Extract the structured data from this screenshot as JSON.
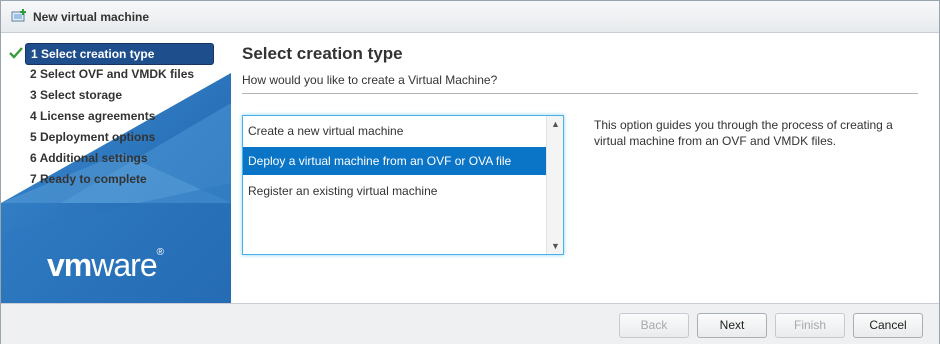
{
  "window": {
    "title": "New virtual machine",
    "icon": "new-vm-icon"
  },
  "sidebar": {
    "steps": [
      {
        "label": "1 Select creation type",
        "active": true,
        "completed": true
      },
      {
        "label": "2 Select OVF and VMDK files"
      },
      {
        "label": "3 Select storage"
      },
      {
        "label": "4 License agreements"
      },
      {
        "label": "5 Deployment options"
      },
      {
        "label": "6 Additional settings"
      },
      {
        "label": "7 Ready to complete"
      }
    ],
    "logo": {
      "bold": "vm",
      "rest": "ware",
      "mark": "®"
    }
  },
  "main": {
    "heading": "Select creation type",
    "question": "How would you like to create a Virtual Machine?",
    "options": [
      {
        "label": "Create a new virtual machine"
      },
      {
        "label": "Deploy a virtual machine from an OVF or OVA file",
        "selected": true
      },
      {
        "label": "Register an existing virtual machine"
      }
    ],
    "description": "This option guides you through the process of creating a virtual machine from an OVF and VMDK files."
  },
  "footer": {
    "back": "Back",
    "next": "Next",
    "finish": "Finish",
    "cancel": "Cancel"
  },
  "colors": {
    "accent": "#0a74c6",
    "active_step": "#1f4e8c",
    "sidebar_blue": "#2f7ec2",
    "check_green": "#3c9b3c"
  }
}
